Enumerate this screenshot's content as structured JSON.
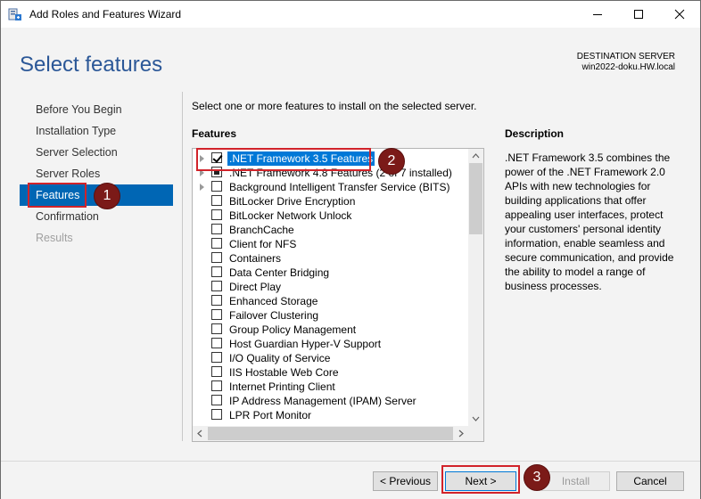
{
  "window": {
    "title": "Add Roles and Features Wizard"
  },
  "header": {
    "page_title": "Select features",
    "destination_label": "DESTINATION SERVER",
    "destination_server": "win2022-doku.HW.local"
  },
  "nav": {
    "items": [
      {
        "label": "Before You Begin",
        "state": "normal"
      },
      {
        "label": "Installation Type",
        "state": "normal"
      },
      {
        "label": "Server Selection",
        "state": "normal"
      },
      {
        "label": "Server Roles",
        "state": "normal"
      },
      {
        "label": "Features",
        "state": "active"
      },
      {
        "label": "Confirmation",
        "state": "normal"
      },
      {
        "label": "Results",
        "state": "disabled"
      }
    ]
  },
  "main": {
    "instruction": "Select one or more features to install on the selected server.",
    "features_label": "Features",
    "features": [
      {
        "label": ".NET Framework 3.5 Features",
        "checkbox": "checked",
        "expandable": true,
        "selected": true
      },
      {
        "label": ".NET Framework 4.8 Features (2 of 7 installed)",
        "checkbox": "partial",
        "expandable": true,
        "selected": false
      },
      {
        "label": "Background Intelligent Transfer Service (BITS)",
        "checkbox": "unchecked",
        "expandable": true,
        "selected": false
      },
      {
        "label": "BitLocker Drive Encryption",
        "checkbox": "unchecked",
        "expandable": false,
        "selected": false
      },
      {
        "label": "BitLocker Network Unlock",
        "checkbox": "unchecked",
        "expandable": false,
        "selected": false
      },
      {
        "label": "BranchCache",
        "checkbox": "unchecked",
        "expandable": false,
        "selected": false
      },
      {
        "label": "Client for NFS",
        "checkbox": "unchecked",
        "expandable": false,
        "selected": false
      },
      {
        "label": "Containers",
        "checkbox": "unchecked",
        "expandable": false,
        "selected": false
      },
      {
        "label": "Data Center Bridging",
        "checkbox": "unchecked",
        "expandable": false,
        "selected": false
      },
      {
        "label": "Direct Play",
        "checkbox": "unchecked",
        "expandable": false,
        "selected": false
      },
      {
        "label": "Enhanced Storage",
        "checkbox": "unchecked",
        "expandable": false,
        "selected": false
      },
      {
        "label": "Failover Clustering",
        "checkbox": "unchecked",
        "expandable": false,
        "selected": false
      },
      {
        "label": "Group Policy Management",
        "checkbox": "unchecked",
        "expandable": false,
        "selected": false
      },
      {
        "label": "Host Guardian Hyper-V Support",
        "checkbox": "unchecked",
        "expandable": false,
        "selected": false
      },
      {
        "label": "I/O Quality of Service",
        "checkbox": "unchecked",
        "expandable": false,
        "selected": false
      },
      {
        "label": "IIS Hostable Web Core",
        "checkbox": "unchecked",
        "expandable": false,
        "selected": false
      },
      {
        "label": "Internet Printing Client",
        "checkbox": "unchecked",
        "expandable": false,
        "selected": false
      },
      {
        "label": "IP Address Management (IPAM) Server",
        "checkbox": "unchecked",
        "expandable": false,
        "selected": false
      },
      {
        "label": "LPR Port Monitor",
        "checkbox": "unchecked",
        "expandable": false,
        "selected": false
      }
    ],
    "description_title": "Description",
    "description_text": ".NET Framework 3.5 combines the power of the .NET Framework 2.0 APIs with new technologies for building applications that offer appealing user interfaces, protect your customers' personal identity information, enable seamless and secure communication, and provide the ability to model a range of business processes."
  },
  "footer": {
    "previous_label": "< Previous",
    "next_label": "Next >",
    "install_label": "Install",
    "cancel_label": "Cancel"
  },
  "callouts": [
    "1",
    "2",
    "3"
  ],
  "colors": {
    "title_blue": "#2b5797",
    "nav_active": "#0066b4",
    "callout_red": "#d1232a",
    "badge_dark_red": "#7b1a18"
  }
}
